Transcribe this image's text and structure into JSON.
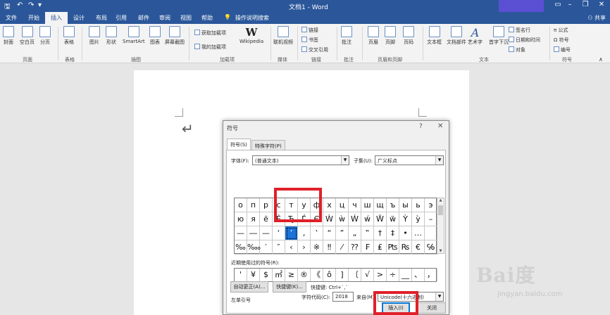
{
  "titlebar": {
    "title": "文档1  -  Word"
  },
  "tabs": [
    "文件",
    "开始",
    "插入",
    "设计",
    "布局",
    "引用",
    "邮件",
    "审阅",
    "视图",
    "帮助",
    "操作说明搜索"
  ],
  "share_label": "共享",
  "ribbon": {
    "groups": [
      {
        "label": "页面",
        "buttons": [
          "封面",
          "空白页",
          "分页"
        ]
      },
      {
        "label": "表格",
        "buttons": [
          "表格"
        ]
      },
      {
        "label": "插图",
        "buttons": [
          "图片",
          "形状",
          "SmartArt",
          "图表",
          "屏幕截图"
        ]
      },
      {
        "label": "加载项",
        "buttons": [
          "获取加载项",
          "我的加载项",
          "Wikipedia"
        ]
      },
      {
        "label": "媒体",
        "buttons": [
          "联机视频"
        ]
      },
      {
        "label": "链接",
        "buttons": [
          "链接",
          "书签",
          "交叉引用"
        ]
      },
      {
        "label": "批注",
        "buttons": [
          "批注"
        ]
      },
      {
        "label": "页眉和页脚",
        "buttons": [
          "页眉",
          "页脚",
          "页码"
        ]
      },
      {
        "label": "文本",
        "buttons": [
          "文本框",
          "文档部件",
          "艺术字",
          "首字下沉",
          "签名行",
          "日期和时间",
          "对象"
        ]
      },
      {
        "label": "符号",
        "buttons": [
          "公式",
          "符号",
          "编号"
        ]
      }
    ]
  },
  "dialog": {
    "title": "符号",
    "tabs": [
      "符号(S)",
      "特殊字符(P)"
    ],
    "font_label": "字体(F):",
    "font_value": "(普通文本)",
    "subset_label": "子集(U):",
    "subset_value": "广义标点",
    "grid_rows": [
      [
        "о",
        "п",
        "р",
        "с",
        "т",
        "у",
        "ф",
        "х",
        "ц",
        "ч",
        "ш",
        "щ",
        "ъ",
        "ы",
        "ь",
        "э"
      ],
      [
        "ю",
        "я",
        "ё",
        "Ѐ",
        "Ђ",
        "Ѓ",
        "Є",
        "Ẁ",
        "ẁ",
        "Ẃ",
        "ẃ",
        "Ẅ",
        "ẅ",
        "Ỳ",
        "ỳ",
        "–"
      ],
      [
        "—",
        "―",
        "—",
        "‘",
        "’",
        "‚",
        "‛",
        "“",
        "”",
        "„",
        "‟",
        "†",
        "‡",
        "•",
        "…",
        ""
      ],
      [
        "‰",
        "‱",
        "′",
        "″",
        "‹",
        "›",
        "※",
        "‼",
        "⁄",
        "⁇",
        "₣",
        "₤",
        "₧",
        "₨",
        "€",
        "℅"
      ]
    ],
    "selected_char": "’",
    "recent_label": "近期使用过的符号(R):",
    "recent_chars": [
      "'",
      "¥",
      "$",
      "㎡",
      "≥",
      "®",
      "《",
      "ô",
      "]",
      "〔",
      "√",
      ">",
      "÷",
      "__",
      "、",
      "，"
    ],
    "unicode_name_label": "Unicode 名称:",
    "char_name": "左单引号",
    "char_code_label": "字符代码(C):",
    "char_code_value": "2018",
    "from_label": "来自(M):",
    "from_value": "Unicode(十六进制)",
    "autocorrect_btn": "自动更正(A)...",
    "shortcut_key_btn": "快捷键(K)...",
    "shortcut_text": "快捷键: Ctrl+`,`",
    "insert_btn": "插入(I)",
    "close_btn": "关闭"
  },
  "watermark": {
    "logo": "Bai度",
    "url": "jingyan.baidu.com"
  },
  "colors": {
    "accent": "#2b579a",
    "highlight": "#e0202a",
    "selection": "#1e73d9"
  }
}
